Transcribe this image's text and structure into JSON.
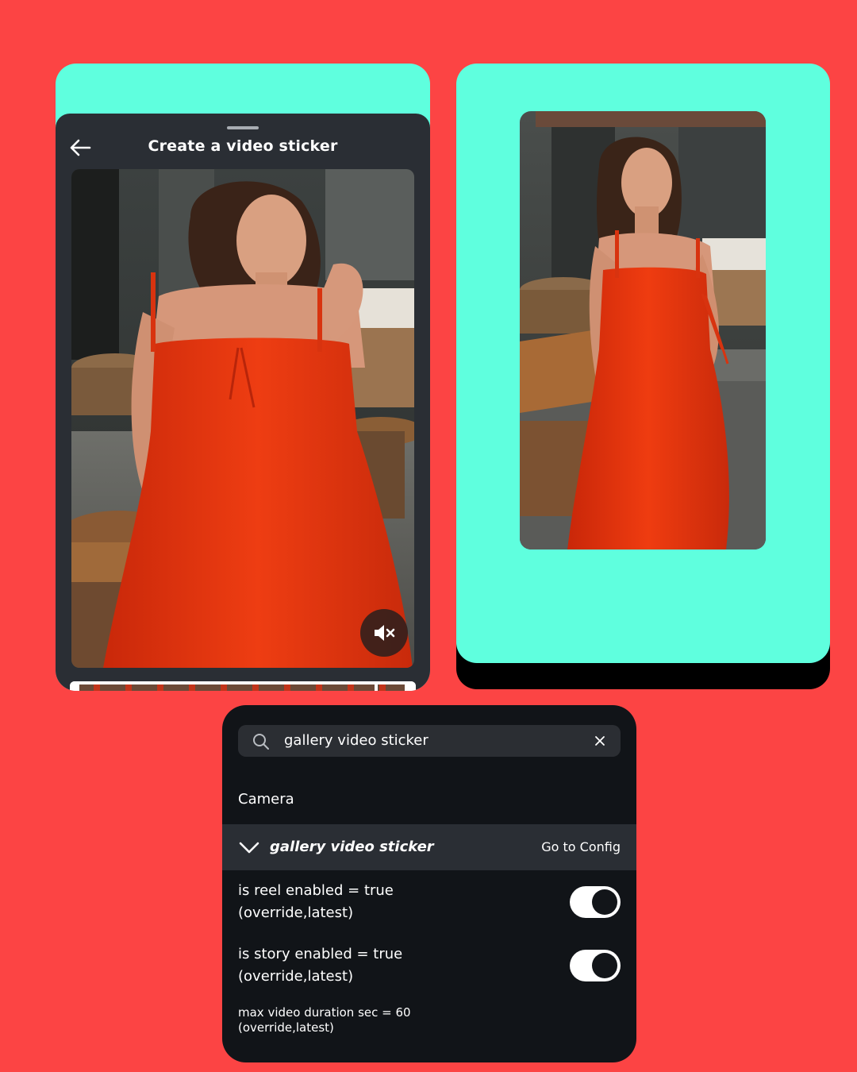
{
  "sticker_sheet": {
    "title": "Create a video sticker",
    "back_icon": "arrow-left-icon",
    "mute_icon": "speaker-muted-icon"
  },
  "config_panel": {
    "search": {
      "value": "gallery video sticker",
      "icon": "search-icon",
      "clear_icon": "close-icon"
    },
    "section_label": "Camera",
    "group": {
      "name": "gallery video sticker",
      "action_label": "Go to Config",
      "expanded": true
    },
    "settings": [
      {
        "line1": "is reel enabled = true",
        "line2": "(override,latest)",
        "toggle": true
      },
      {
        "line1": "is story enabled = true",
        "line2": "(override,latest)",
        "toggle": true
      },
      {
        "line1": "max video duration sec = 60",
        "line2": "(override,latest)"
      }
    ]
  },
  "colors": {
    "background": "#fc4444",
    "card_accent": "#5fffde",
    "sheet": "#2a2e34",
    "panel": "#111418",
    "dress": "#e8340c"
  }
}
